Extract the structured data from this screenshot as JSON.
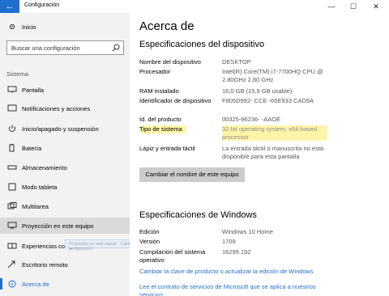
{
  "titlebar": {
    "back": "←",
    "title": "Configuración",
    "minimize": "—",
    "maximize": "☐",
    "close": "✕"
  },
  "sidebar": {
    "home": "Inicio",
    "search_placeholder": "Buscar una configuración",
    "section": "Sistema",
    "items": [
      {
        "label": "Pantalla"
      },
      {
        "label": "Notificaciones y acciones"
      },
      {
        "label": "Inicio/apagado y suspensión"
      },
      {
        "label": "Batería"
      },
      {
        "label": "Almacenamiento"
      },
      {
        "label": "Modo tableta"
      },
      {
        "label": "Multitarea"
      },
      {
        "label": "Proyección en este equipo"
      },
      {
        "label": "Experiencias compartidas"
      },
      {
        "label": "Escritorio remoto"
      },
      {
        "label": "Acerca de"
      }
    ],
    "tooltip": "Proyección en este equipo · Cambiar la configuración"
  },
  "main": {
    "title": "Acerca de",
    "device_heading": "Especificaciones del dispositivo",
    "device_specs": [
      {
        "key": "Nombre del dispositivo",
        "value": "DESKTOP"
      },
      {
        "key": "Procesador",
        "value": "Intel(R) Core(TM) i7-7700HQ CPU @ 2.80GHz   2.80 GHz"
      },
      {
        "key": "RAM instalado",
        "value": "16,0 GB (15,9 GB usable)"
      },
      {
        "key": "Identificador de dispositivo",
        "value": "F805D992-            CCE           -65E933 CAD9A"
      },
      {
        "key": "Id. del producto",
        "value": "00325-96236-          -AAOE"
      },
      {
        "key": "Tipo de sistema",
        "value": "32-bit operating system, x64-based processor"
      },
      {
        "key": "Lápiz y entrada táctil",
        "value": "La entrada táctil o manuscrita no está disponible para esta pantalla"
      }
    ],
    "rename_button": "Cambiar el nombre de este equipo",
    "windows_heading": "Especificaciones de Windows",
    "windows_specs": [
      {
        "key": "Edición",
        "value": "Windows 10 Home"
      },
      {
        "key": "Versión",
        "value": "1709"
      },
      {
        "key": "Compilación del sistema operativo",
        "value": "16299.192"
      }
    ],
    "link_product_key": "Cambiar la clave de producto o actualizar la edición de Windows",
    "link_services": "Lee el contrato de servicios de Microsoft que se aplica a nuestros servicios"
  },
  "colors": {
    "accent": "#1f6fd1",
    "highlight": "#fff5a8",
    "sidebar_bg": "#f2f2f2"
  }
}
